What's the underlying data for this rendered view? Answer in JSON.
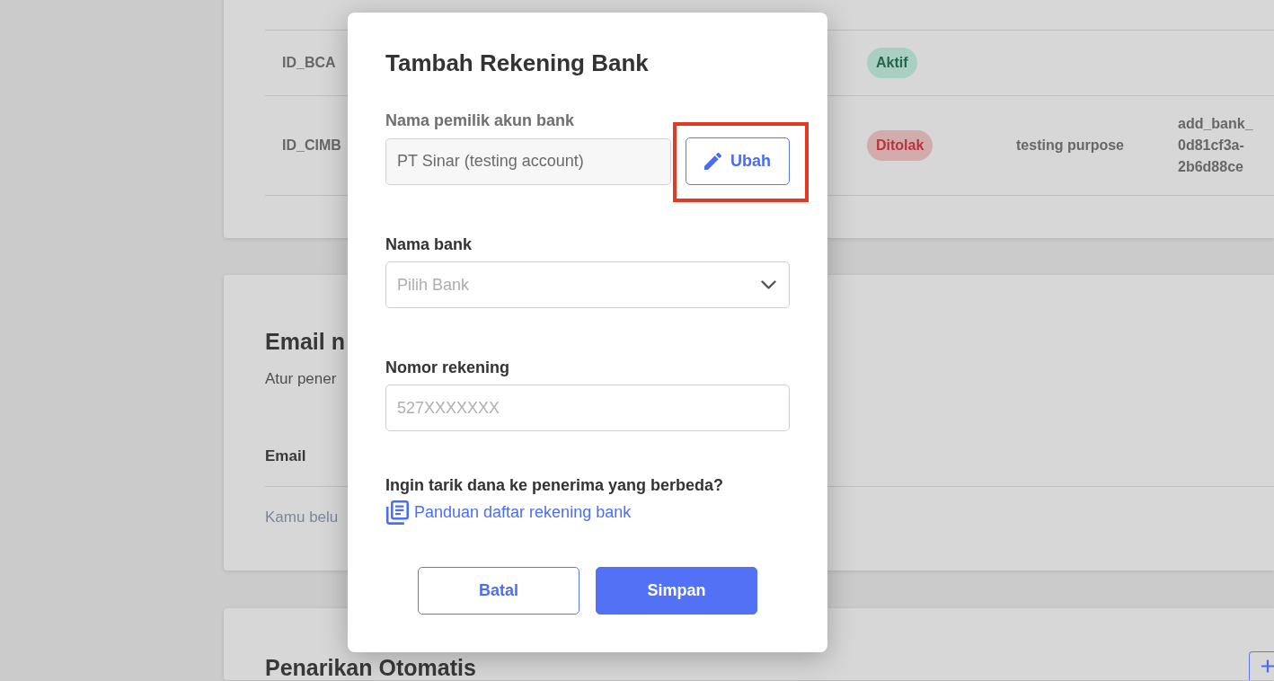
{
  "background": {
    "accounts_table": {
      "rows": [
        {
          "column_1": "ID_BCA",
          "column_4": {
            "label": "Aktif",
            "kind": "success"
          }
        },
        {
          "column_1": "ID_CIMB",
          "column_4": {
            "label": "Ditolak",
            "kind": "danger"
          },
          "column_5": "testing purpose",
          "column_6": "add_bank_\n0d81cf3a-\n2b6d88ce"
        }
      ]
    },
    "email_section": {
      "title": "Email n",
      "subtitle": "Atur pener",
      "column_header": "Email",
      "empty_message": "Kamu belu"
    },
    "auto_withdrawal_section": {
      "title": "Penarikan Otomatis"
    }
  },
  "modal": {
    "title": "Tambah Rekening Bank",
    "fields": [
      {
        "kind": "readonly",
        "label": "Nama pemilik akun bank",
        "value": "PT Sinar (testing account)",
        "disabled": true,
        "button": {
          "label": "Ubah",
          "highlighted": true
        }
      },
      {
        "kind": "select",
        "label": "Nama bank",
        "placeholder": "Pilih Bank",
        "disabled": false
      },
      {
        "kind": "text",
        "label": "Nomor rekening",
        "placeholder": "527XXXXXXX",
        "disabled": false
      }
    ],
    "help": {
      "question": "Ingin tarik dana ke penerima yang berbeda?",
      "link": "Panduan daftar rekening bank"
    },
    "buttons": [
      {
        "label": "Batal",
        "kind": "secondary"
      },
      {
        "label": "Simpan",
        "kind": "primary"
      }
    ]
  }
}
